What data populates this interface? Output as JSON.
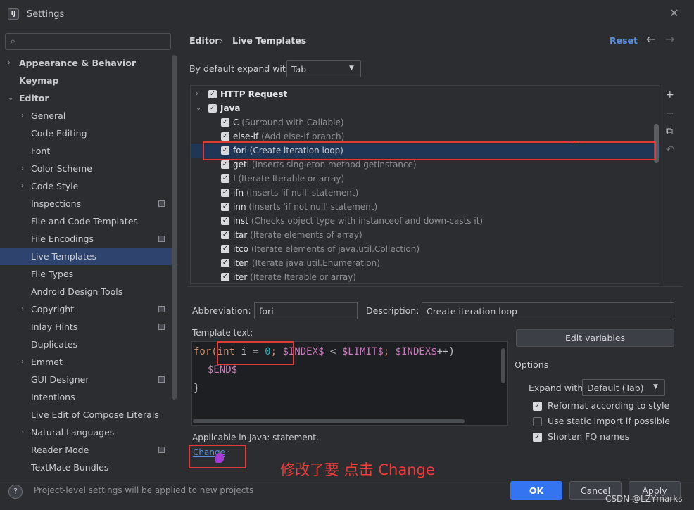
{
  "window": {
    "title": "Settings",
    "logo_text": "IJ"
  },
  "sidebar": {
    "search_placeholder": "",
    "items": [
      {
        "label": "Appearance & Behavior",
        "arrow": "›",
        "bold": true
      },
      {
        "label": "Keymap",
        "bold": true
      },
      {
        "label": "Editor",
        "arrow": "⌄",
        "bold": true
      },
      {
        "label": "General",
        "arrow": "›"
      },
      {
        "label": "Code Editing"
      },
      {
        "label": "Font"
      },
      {
        "label": "Color Scheme",
        "arrow": "›"
      },
      {
        "label": "Code Style",
        "arrow": "›"
      },
      {
        "label": "Inspections",
        "project": true
      },
      {
        "label": "File and Code Templates"
      },
      {
        "label": "File Encodings",
        "project": true
      },
      {
        "label": "Live Templates",
        "selected": true
      },
      {
        "label": "File Types"
      },
      {
        "label": "Android Design Tools"
      },
      {
        "label": "Copyright",
        "arrow": "›",
        "project": true
      },
      {
        "label": "Inlay Hints",
        "project": true
      },
      {
        "label": "Duplicates"
      },
      {
        "label": "Emmet",
        "arrow": "›"
      },
      {
        "label": "GUI Designer",
        "project": true
      },
      {
        "label": "Intentions"
      },
      {
        "label": "Live Edit of Compose Literals"
      },
      {
        "label": "Natural Languages",
        "arrow": "›"
      },
      {
        "label": "Reader Mode",
        "project": true
      },
      {
        "label": "TextMate Bundles"
      }
    ]
  },
  "header": {
    "breadcrumb_editor": "Editor",
    "breadcrumb_sep": "›",
    "breadcrumb_current": "Live Templates",
    "reset": "Reset",
    "back": "←",
    "forward": "→"
  },
  "expand": {
    "label": "By default expand with",
    "value": "Tab"
  },
  "templates": {
    "groups": [
      {
        "name": "HTTP Request",
        "expanded": false
      },
      {
        "name": "Java",
        "expanded": true
      }
    ],
    "items": [
      {
        "abbr": "C",
        "desc": "(Surround with Callable)"
      },
      {
        "abbr": "else-if",
        "desc": "(Add else-if branch)"
      },
      {
        "abbr": "fori",
        "desc": "(Create iteration loop)",
        "selected": true
      },
      {
        "abbr": "geti",
        "desc": "(Inserts singleton method getInstance)"
      },
      {
        "abbr": "I",
        "desc": "(Iterate Iterable or array)"
      },
      {
        "abbr": "ifn",
        "desc": "(Inserts 'if null' statement)"
      },
      {
        "abbr": "inn",
        "desc": "(Inserts 'if not null' statement)"
      },
      {
        "abbr": "inst",
        "desc": "(Checks object type with instanceof and down-casts it)"
      },
      {
        "abbr": "itar",
        "desc": "(Iterate elements of array)"
      },
      {
        "abbr": "itco",
        "desc": "(Iterate elements of java.util.Collection)"
      },
      {
        "abbr": "iten",
        "desc": "(Iterate java.util.Enumeration)"
      },
      {
        "abbr": "iter",
        "desc": "(Iterate Iterable or array)"
      }
    ],
    "tools": [
      "+",
      "−",
      "⧉",
      "↶"
    ]
  },
  "details": {
    "abbr_label": "Abbreviation:",
    "abbr_value": "fori",
    "desc_label": "Description:",
    "desc_value": "Create iteration loop",
    "template_label": "Template text:",
    "code": {
      "l1_for": "for(",
      "l1_int": "int",
      "l1_i": " i = ",
      "l1_zero": "0",
      "l1_semi": "; ",
      "l1_index": "$INDEX$",
      "l1_lt": " < ",
      "l1_limit": "$LIMIT$",
      "l1_semi2": "; ",
      "l1_index2": "$INDEX$",
      "l1_end": "++)",
      "l2": "$END$",
      "l3": "}"
    },
    "edit_variables": "Edit variables",
    "options_label": "Options",
    "expand_with_label": "Expand with",
    "expand_with_value": "Default (Tab)",
    "options": [
      {
        "label": "Reformat according to style",
        "checked": true
      },
      {
        "label": "Use static import if possible",
        "checked": false
      },
      {
        "label": "Shorten FQ names",
        "checked": true
      }
    ],
    "applicable": "Applicable in Java: statement.",
    "change": "Change"
  },
  "annotation": "修改了要    点击    Change",
  "footer": {
    "help": "?",
    "note": "Project-level settings will be applied to new projects",
    "ok": "OK",
    "cancel": "Cancel",
    "apply": "Apply",
    "watermark": "CSDN @LZYmarks"
  },
  "colors": {
    "accent": "#3574f0",
    "selection": "#2e436e",
    "annotation": "#e03a3a"
  }
}
